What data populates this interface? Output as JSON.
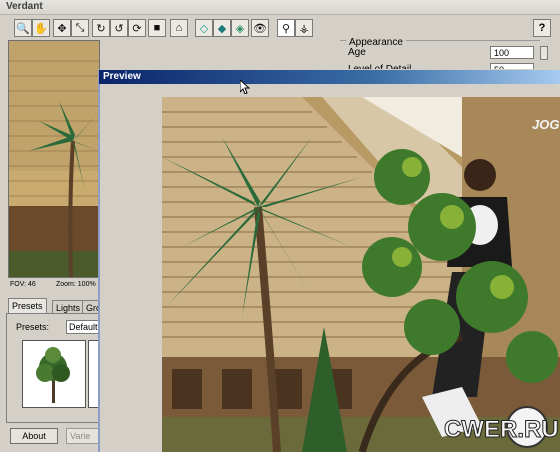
{
  "main_window": {
    "title": "Verdant"
  },
  "toolbar": {
    "buttons": [
      {
        "icon": "zoom-icon",
        "glyph": "🔍"
      },
      {
        "icon": "hand-icon",
        "glyph": "✋"
      },
      {
        "icon": "move-icon",
        "glyph": "✥"
      },
      {
        "icon": "scale-icon",
        "glyph": "⤡"
      },
      {
        "icon": "rotate-cw-icon",
        "glyph": "↻"
      },
      {
        "icon": "rotate-ccw-icon",
        "glyph": "↺"
      },
      {
        "icon": "refresh-icon",
        "glyph": "⟳"
      },
      {
        "icon": "stop-icon",
        "glyph": "■"
      },
      {
        "icon": "home-icon",
        "glyph": "⌂"
      },
      {
        "icon": "wireframe-icon",
        "glyph": "◇"
      },
      {
        "icon": "solid-icon",
        "glyph": "◆"
      },
      {
        "icon": "textured-icon",
        "glyph": "◈"
      },
      {
        "icon": "preview-eye-icon",
        "glyph": "👁"
      },
      {
        "icon": "single-tree-icon",
        "glyph": "⚲"
      },
      {
        "icon": "forest-icon",
        "glyph": "⚶"
      }
    ],
    "help_label": "?"
  },
  "viewport": {
    "fov_text": "FOV: 46",
    "zoom_text": "Zoom: 100%"
  },
  "tabs": [
    {
      "label": "Presets"
    },
    {
      "label": "Lights"
    },
    {
      "label": "Gro"
    }
  ],
  "presets": {
    "label": "Presets:",
    "selected": "Default"
  },
  "buttons": {
    "about": "About",
    "variety": "Varie"
  },
  "properties": {
    "group_label": "Appearance",
    "age_label": "Age",
    "age_value": "100",
    "lod_label": "Level of Detail",
    "lod_value": "50"
  },
  "preview_window": {
    "title": "Preview"
  },
  "scene": {
    "sign_text": "JOGA BONITO",
    "sign_text_right": "JOG",
    "watermark": "CWER.RU"
  },
  "colors": {
    "titlebar_start": "#0a246a",
    "titlebar_end": "#a6caf0",
    "window_face": "#d4d0c8"
  }
}
